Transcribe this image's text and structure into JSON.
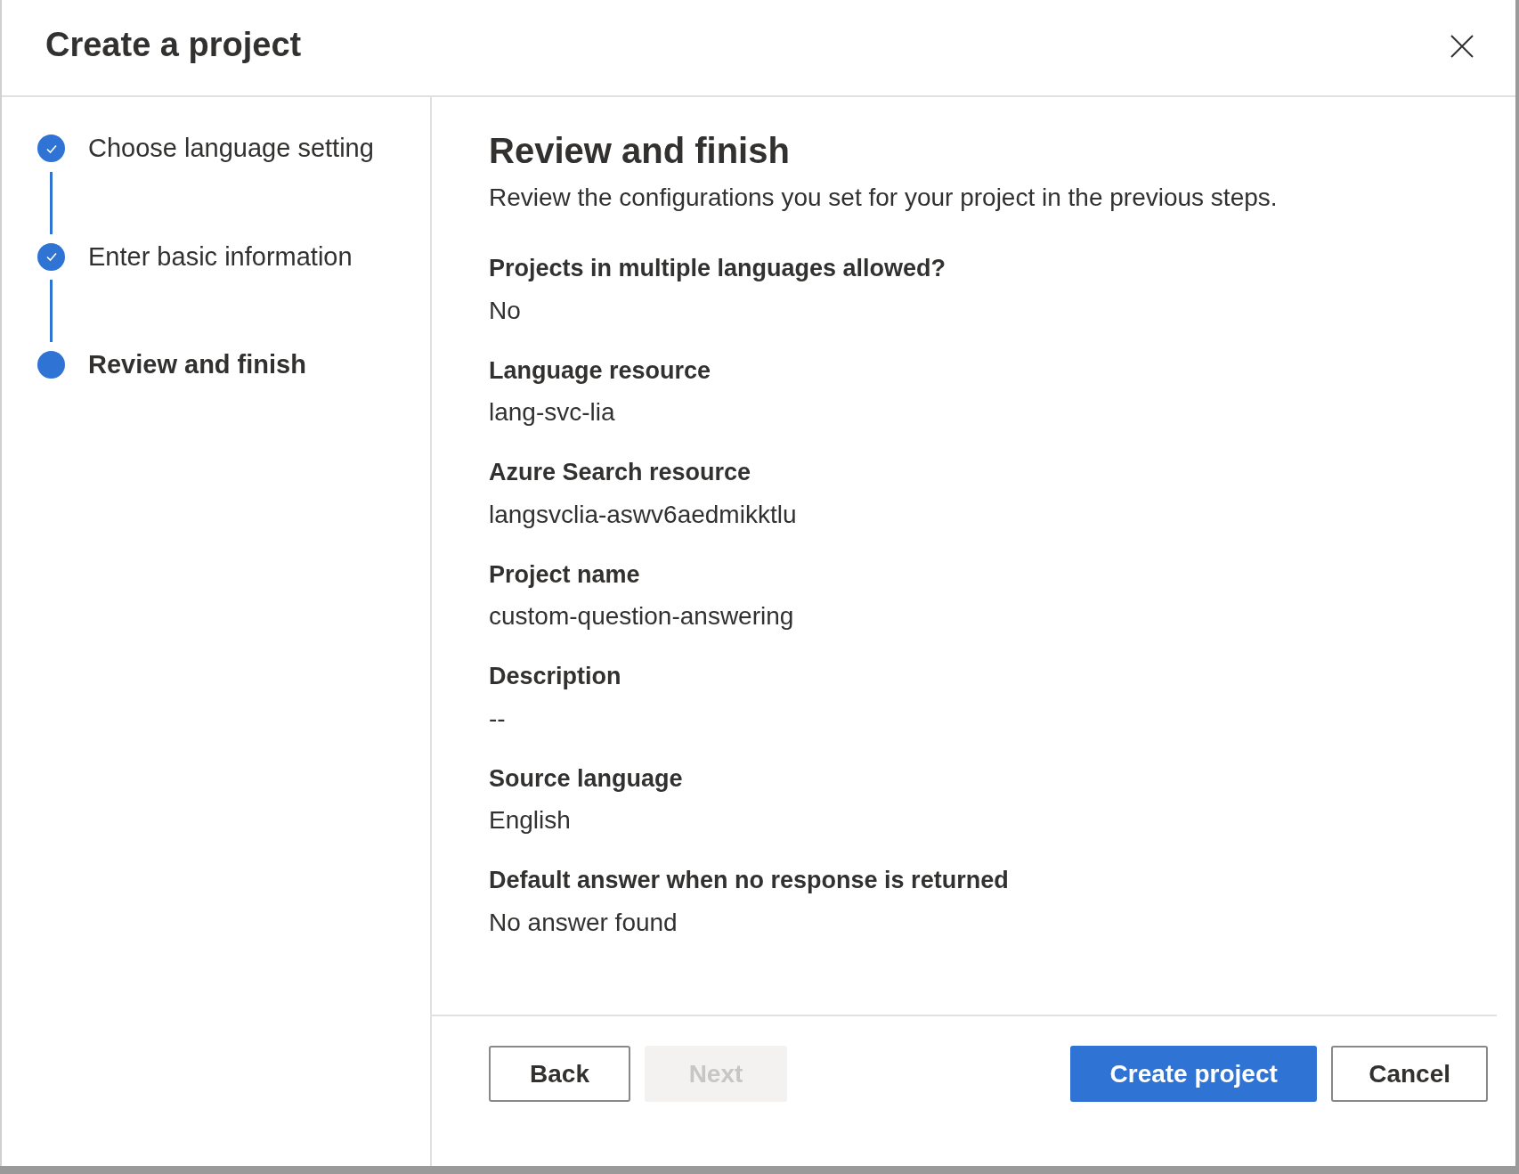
{
  "dialog": {
    "title": "Create a project"
  },
  "steps": [
    {
      "label": "Choose language setting",
      "completed": true,
      "selected": false
    },
    {
      "label": "Enter basic information",
      "completed": true,
      "selected": false
    },
    {
      "label": "Review and finish",
      "completed": false,
      "selected": true
    }
  ],
  "review": {
    "heading": "Review and finish",
    "subtitle": "Review the configurations you set for your project in the previous steps.",
    "items": [
      {
        "label": "Projects in multiple languages allowed?",
        "value": "No"
      },
      {
        "label": "Language resource",
        "value": "lang-svc-lia"
      },
      {
        "label": "Azure Search resource",
        "value": "langsvclia-aswv6aedmikktlu"
      },
      {
        "label": "Project name",
        "value": "custom-question-answering"
      },
      {
        "label": "Description",
        "value": "--"
      },
      {
        "label": "Source language",
        "value": "English"
      },
      {
        "label": "Default answer when no response is returned",
        "value": "No answer found"
      }
    ]
  },
  "footer": {
    "left_buttons": [
      {
        "label": "Back",
        "kind": "secondary",
        "disabled": false
      },
      {
        "label": "Next",
        "kind": "secondary",
        "disabled": true
      }
    ],
    "right_buttons": [
      {
        "label": "Create project",
        "kind": "primary",
        "disabled": false
      },
      {
        "label": "Cancel",
        "kind": "secondary",
        "disabled": false
      }
    ]
  }
}
